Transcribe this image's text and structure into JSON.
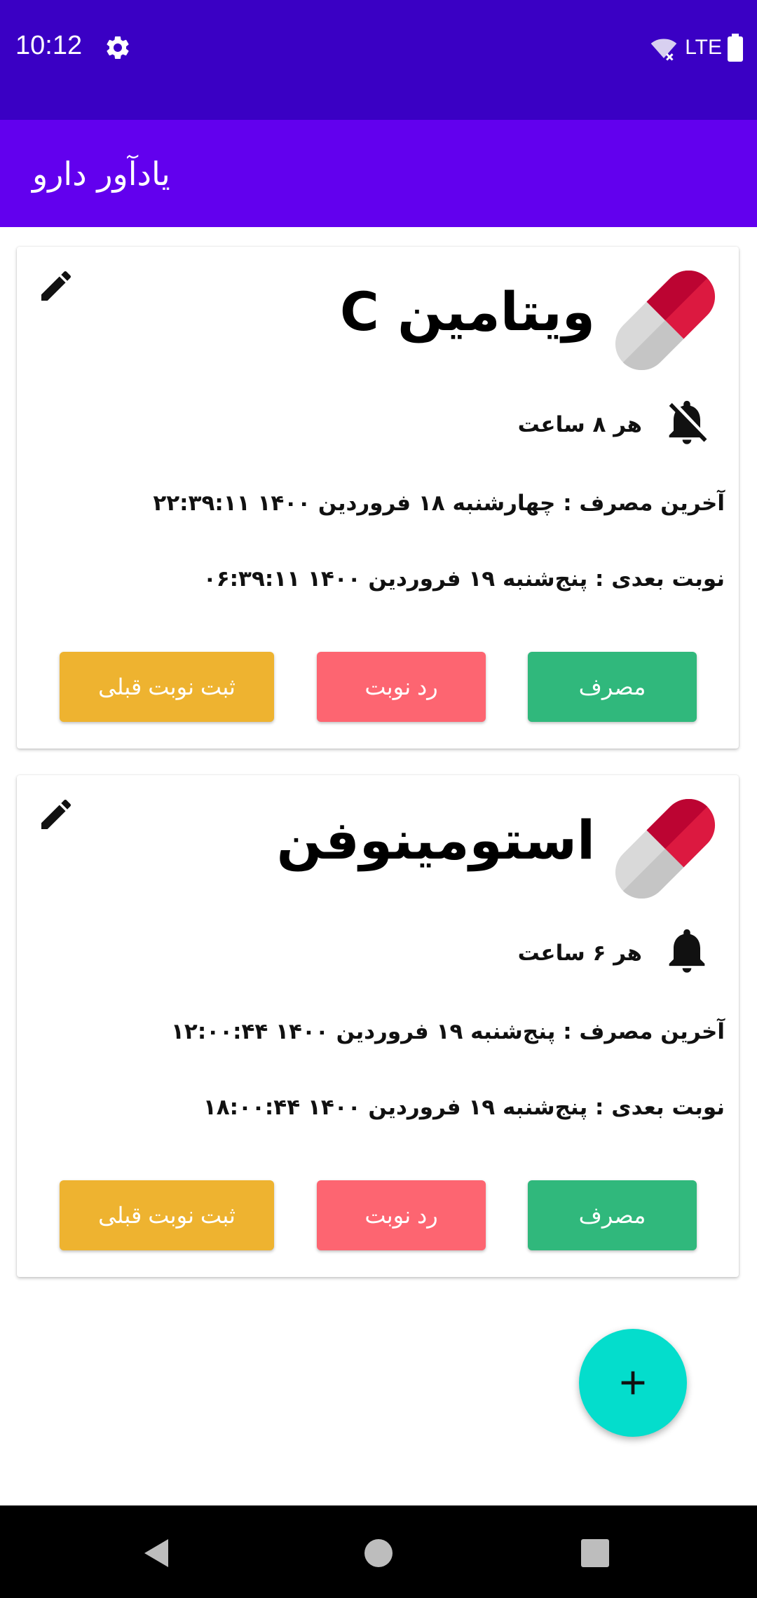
{
  "status_bar": {
    "time": "10:12",
    "network": "LTE"
  },
  "app_bar": {
    "title": "یادآور دارو"
  },
  "medicines": [
    {
      "name": "ویتامین C",
      "interval": "هر ۸ ساعت",
      "notifications_enabled": false,
      "last_dose": "آخرین مصرف : چهارشنبه ۱۸ فروردین ۱۴۰۰ ۲۲:۳۹:۱۱",
      "next_dose": "نوبت بعدی : پنج‌شنبه ۱۹ فروردین ۱۴۰۰ ۰۶:۳۹:۱۱",
      "buttons": {
        "consume": "مصرف",
        "reject": "رد نوبت",
        "record_previous": "ثبت نوبت قبلی"
      }
    },
    {
      "name": "استومینوفن",
      "interval": "هر ۶ ساعت",
      "notifications_enabled": true,
      "last_dose": "آخرین مصرف : پنج‌شنبه ۱۹ فروردین ۱۴۰۰ ۱۲:۰۰:۴۴",
      "next_dose": "نوبت بعدی : پنج‌شنبه ۱۹ فروردین ۱۴۰۰ ۱۸:۰۰:۴۴",
      "buttons": {
        "consume": "مصرف",
        "reject": "رد نوبت",
        "record_previous": "ثبت نوبت قبلی"
      }
    }
  ],
  "fab": {
    "icon": "plus-icon"
  },
  "colors": {
    "status_bar": "#3a00c4",
    "app_bar": "#6200ee",
    "consume_button": "#30b87c",
    "reject_button": "#fd6571",
    "previous_button": "#eeb330",
    "fab": "#04ddcc"
  }
}
